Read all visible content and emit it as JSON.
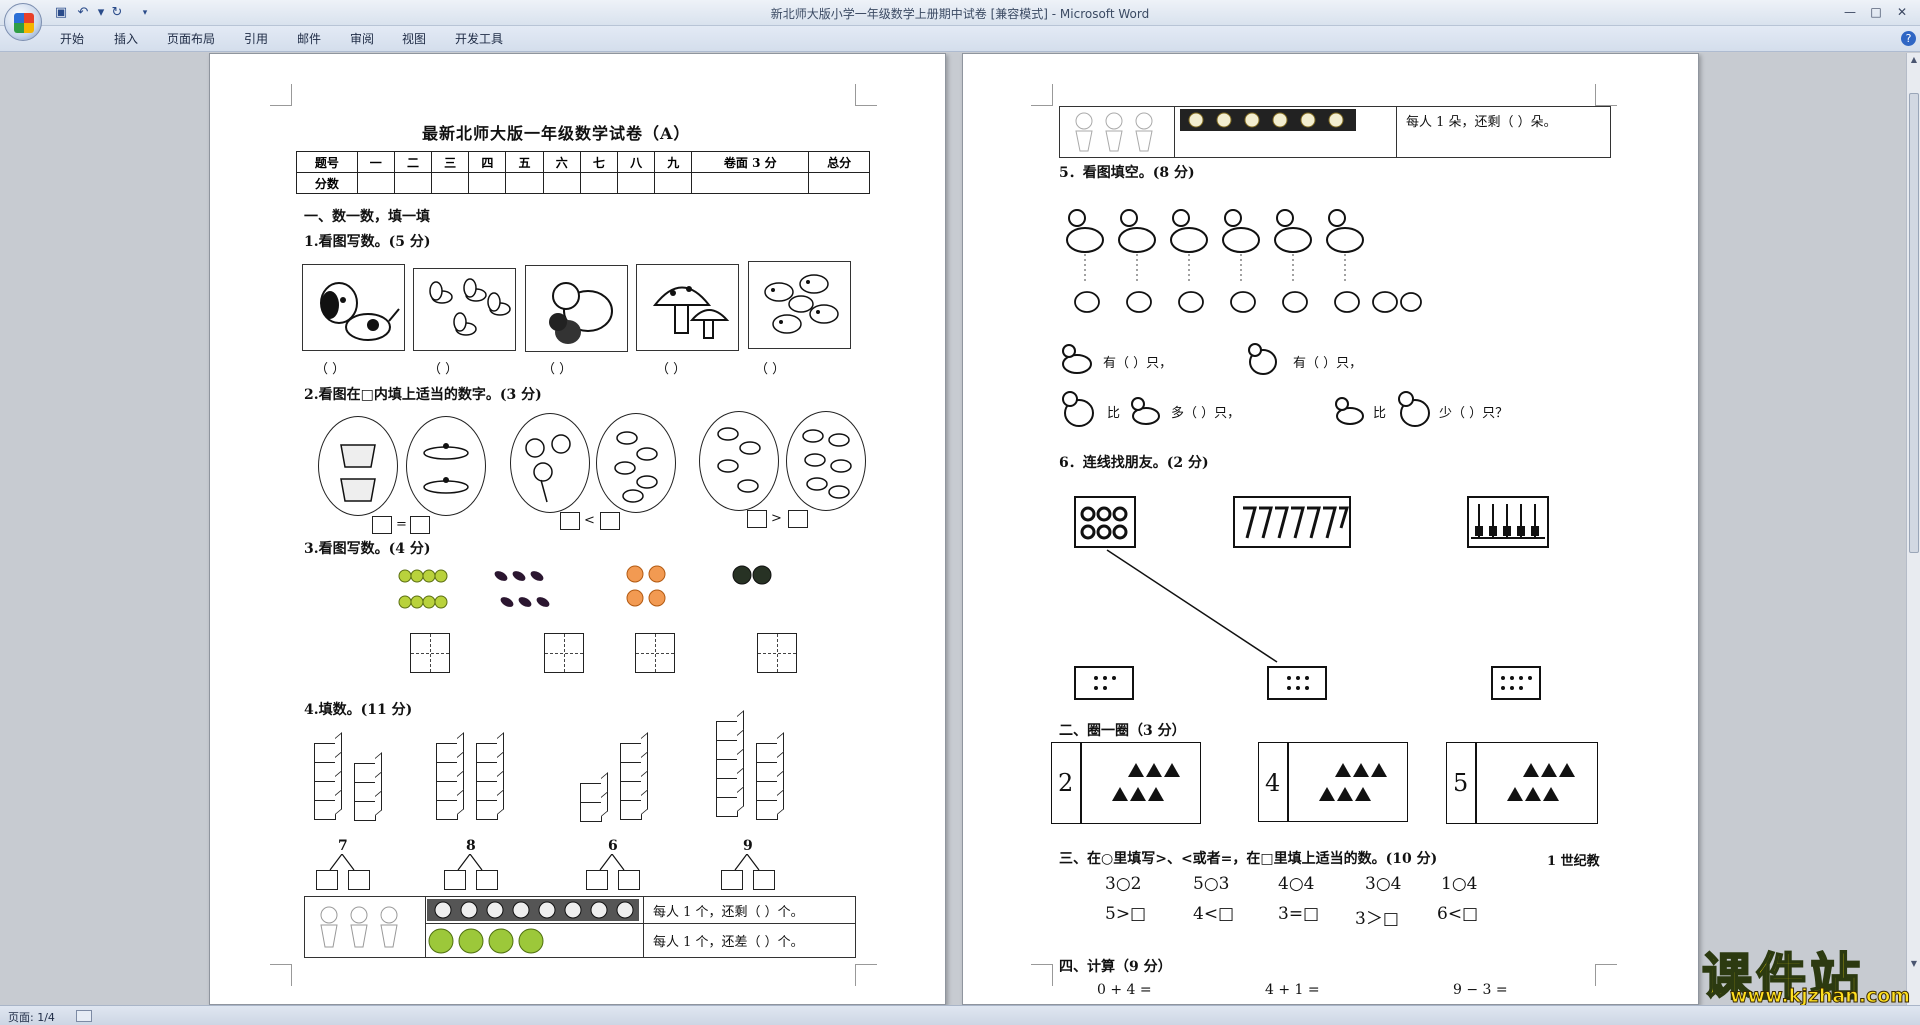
{
  "window": {
    "title": "新北师大版小学一年级数学上册期中试卷 [兼容模式] - Microsoft Word",
    "controls": [
      "—",
      "□",
      "✕"
    ]
  },
  "quick_access": {
    "save": "save-icon",
    "undo": "undo-icon",
    "redo": "redo-icon",
    "customize": "▾"
  },
  "ribbon": {
    "tabs": [
      "开始",
      "插入",
      "页面布局",
      "引用",
      "邮件",
      "审阅",
      "视图",
      "开发工具"
    ]
  },
  "page1": {
    "title": "最新北师大版一年级数学试卷（A）",
    "score_table": {
      "header": [
        "题号",
        "一",
        "二",
        "三",
        "四",
        "五",
        "六",
        "七",
        "八",
        "九",
        "卷面 3 分",
        "总分"
      ],
      "row_label": "分数"
    },
    "section1": "一、数一数，填一填",
    "q1": "1.看图写数。(5 分)",
    "q1_blanks": [
      "（    ）",
      "（    ）",
      "（    ）",
      "（    ）",
      "（    ）"
    ],
    "q2": "2.看图在□内填上适当的数字。(3 分)",
    "q2_ops": [
      "=",
      "<",
      ">"
    ],
    "q3": "3.看图写数。(4 分)",
    "q4": "4.填数。(11 分)",
    "q4_numbers": [
      "7",
      "8",
      "6",
      "9"
    ],
    "share_row1": "每人 1 个，还剩（    ）个。",
    "share_row2": "每人 1 个，还差（    ）个。"
  },
  "page2": {
    "share_top": "每人 1 朵，还剩（    ）朵。",
    "q5": "5．看图填空。(8 分)",
    "q5_line1a": "有（      ）只，",
    "q5_line1b": "有（      ）只，",
    "q5_line2a": "比",
    "q5_line2b": "多（        ）只，",
    "q5_line2c": "比",
    "q5_line2d": "少（        ）只？",
    "q6": "6．连线找朋友。(2 分)",
    "section2": "二、圈一圈（3 分）",
    "circle_numbers": [
      "2",
      "4",
      "5"
    ],
    "section3": "三、在○里填写>、<或者=，在□里填上适当的数。(10 分)",
    "section3_tail": "1 世纪教",
    "compare_row1": [
      "3○2",
      "5○3",
      "4○4",
      "3○4",
      "1○4"
    ],
    "compare_row2": [
      "5>□",
      "4<□",
      "3=□",
      "3＞□",
      "6<□"
    ],
    "section4": "四、计算（9 分）",
    "calc": [
      "0 + 4 =",
      "4 + 1 =",
      "9 − 3 ="
    ]
  },
  "status": {
    "page": "页面: 1/4"
  },
  "watermark": {
    "big": "课件站",
    "url": "www.kjzhan.com"
  }
}
